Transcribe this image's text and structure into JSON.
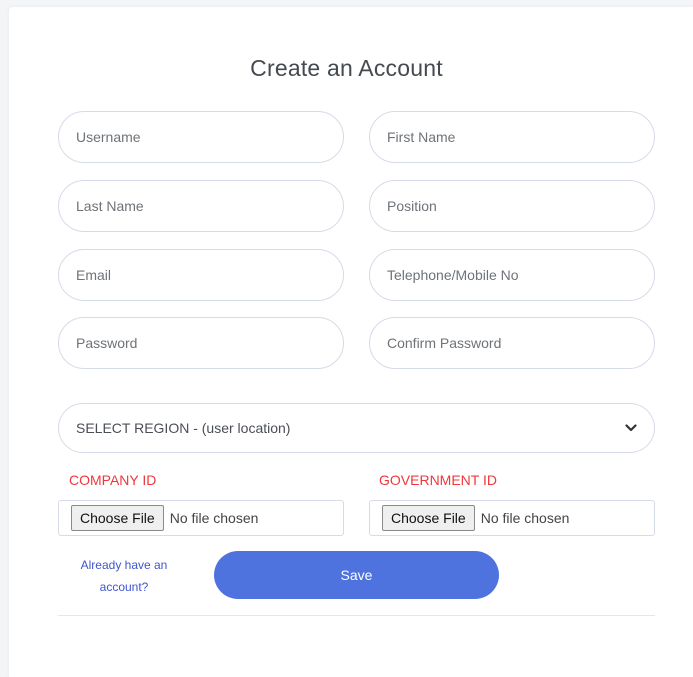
{
  "form": {
    "title": "Create an Account",
    "fields": {
      "username": "Username",
      "first_name": "First Name",
      "last_name": "Last Name",
      "position": "Position",
      "email": "Email",
      "phone": "Telephone/Mobile No",
      "password": "Password",
      "confirm_password": "Confirm Password"
    },
    "region_select": {
      "selected": "SELECT REGION - (user location)",
      "icon": "chevron-down-icon"
    },
    "company_id": {
      "label": "COMPANY ID",
      "button": "Choose File",
      "status": "No file chosen"
    },
    "government_id": {
      "label": "GOVERNMENT ID",
      "button": "Choose File",
      "status": "No file chosen"
    },
    "signin_link": {
      "line1": "Already have an",
      "line2": "account?"
    },
    "save_label": "Save"
  },
  "colors": {
    "accent": "#4e73df",
    "label_red": "#f0373d",
    "link": "#3d57cc",
    "border": "#d6dbe8"
  }
}
